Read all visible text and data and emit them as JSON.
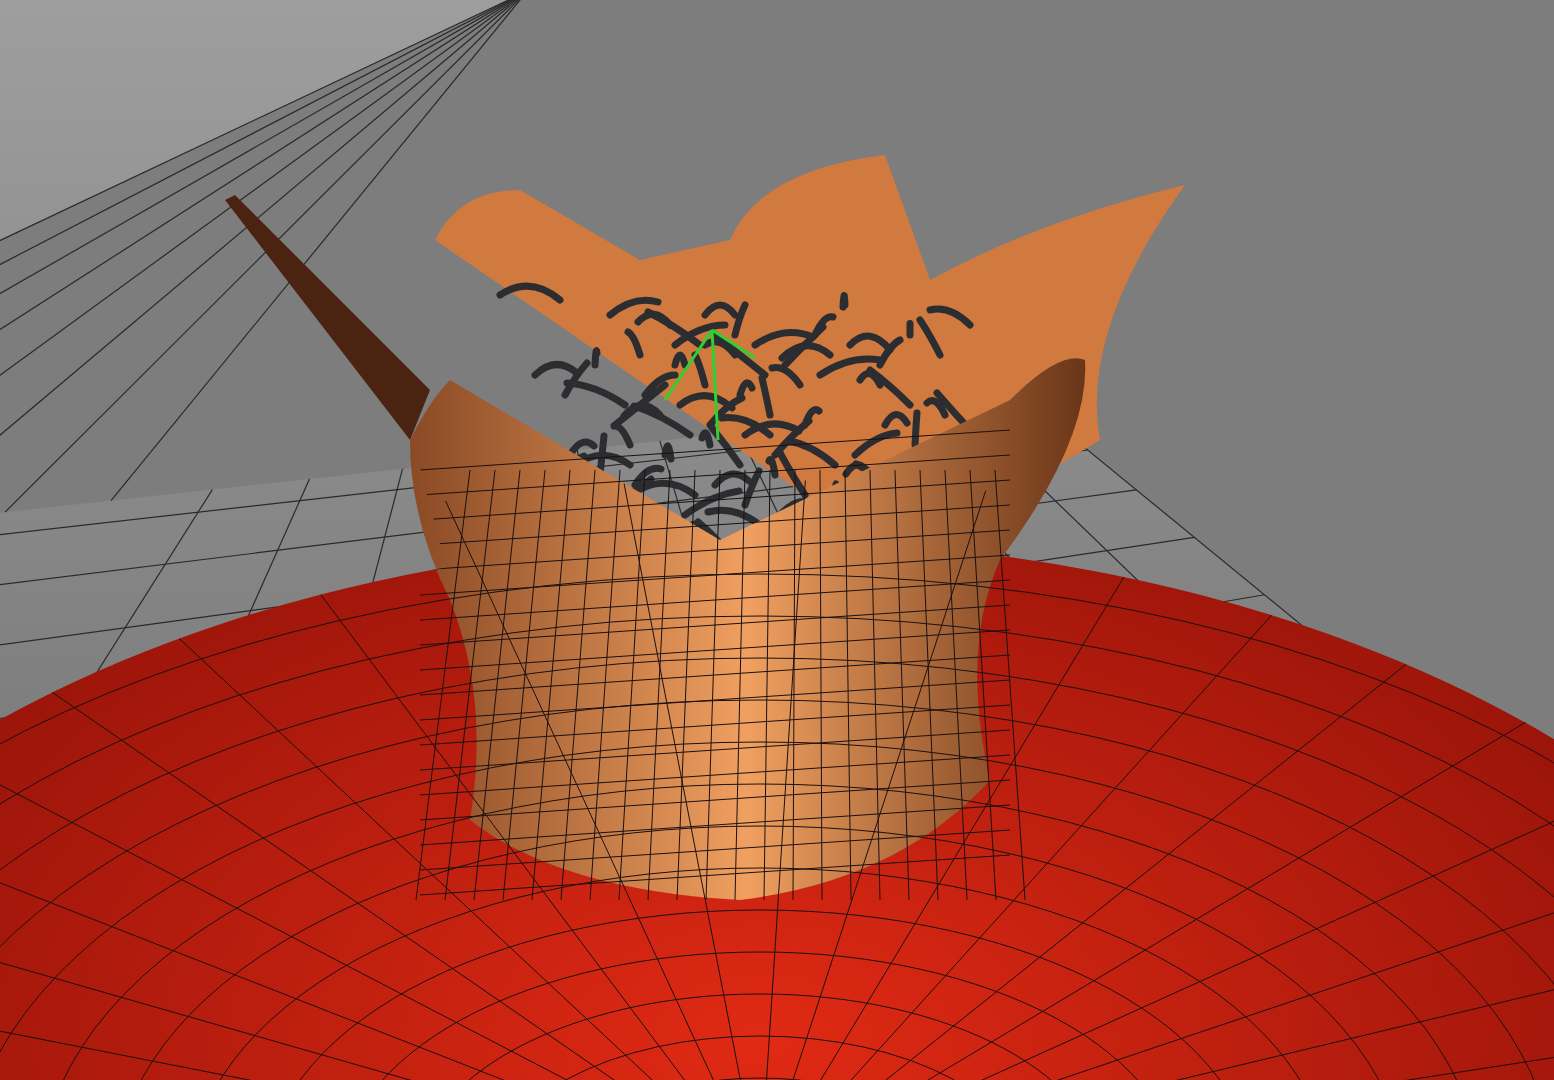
{
  "viewport": {
    "grid_visible": true,
    "wireframe_on_shaded": true,
    "manipulator_visible": true
  }
}
